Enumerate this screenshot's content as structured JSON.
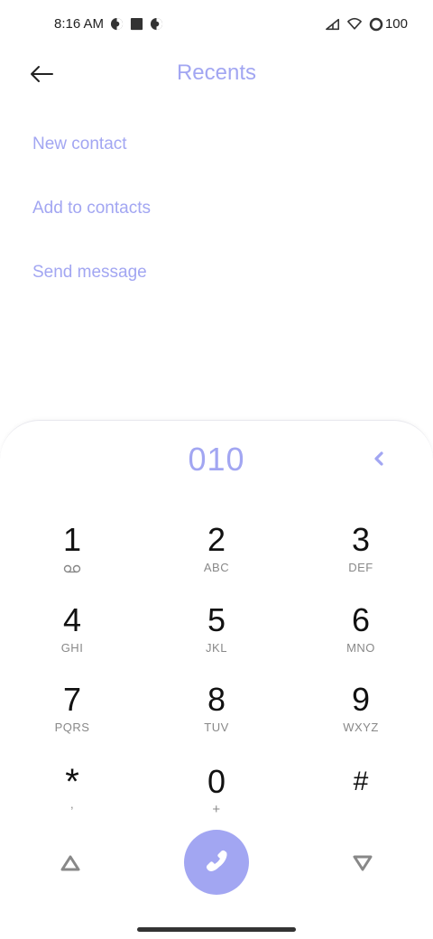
{
  "status_bar": {
    "time": "8:16 AM",
    "battery": "100"
  },
  "header": {
    "title": "Recents"
  },
  "actions": {
    "new_contact": "New contact",
    "add_to_contacts": "Add to contacts",
    "send_message": "Send message"
  },
  "dialer": {
    "number": "010",
    "keys": [
      {
        "digit": "1",
        "letters": ""
      },
      {
        "digit": "2",
        "letters": "ABC"
      },
      {
        "digit": "3",
        "letters": "DEF"
      },
      {
        "digit": "4",
        "letters": "GHI"
      },
      {
        "digit": "5",
        "letters": "JKL"
      },
      {
        "digit": "6",
        "letters": "MNO"
      },
      {
        "digit": "7",
        "letters": "PQRS"
      },
      {
        "digit": "8",
        "letters": "TUV"
      },
      {
        "digit": "9",
        "letters": "WXYZ"
      },
      {
        "digit": "*",
        "letters": ","
      },
      {
        "digit": "0",
        "letters": "+"
      },
      {
        "digit": "#",
        "letters": ""
      }
    ]
  },
  "colors": {
    "accent": "#a2a6f2",
    "text": "#111111",
    "subtext": "#888888"
  },
  "icons": {
    "back": "arrow-left-icon",
    "backspace": "backspace-chevron-icon",
    "voicemail": "voicemail-icon",
    "call": "phone-icon",
    "sim1": "sim-triangle-up-icon",
    "sim2": "sim-triangle-down-icon"
  }
}
